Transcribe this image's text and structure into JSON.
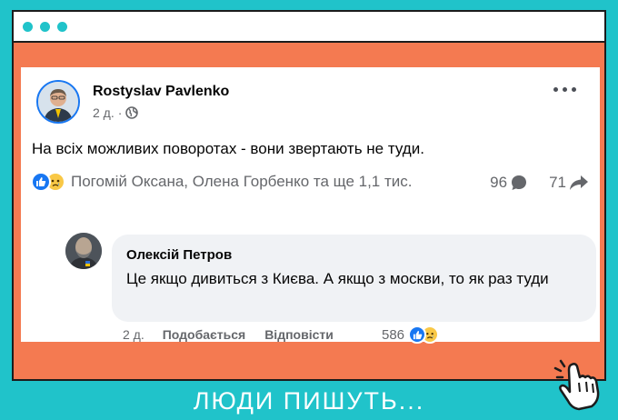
{
  "window": {
    "dots": 3
  },
  "post": {
    "author": "Rostyslav Pavlenko",
    "time": "2 д.",
    "separator": "·",
    "text": "На всіх можливих поворотах - вони звертають не туди.",
    "reactions": {
      "types": [
        "like",
        "sad"
      ],
      "summary": "Погомій Оксана, Олена Горбенко та ще 1,1 тис.",
      "comments_count": "96",
      "shares_count": "71"
    }
  },
  "comment": {
    "author": "Олексій Петров",
    "text": "Це якщо дивиться з Києва. А якщо з москви, то як раз туди",
    "time": "2 д.",
    "like_label": "Подобається",
    "reply_label": "Відповісти",
    "reactions_count": "586",
    "reaction_types": [
      "like",
      "sad"
    ]
  },
  "footer": {
    "caption": "ЛЮДИ ПИШУТЬ..."
  },
  "colors": {
    "background": "#20c3ca",
    "frame": "#f47a51",
    "card": "#ffffff",
    "like_blue": "#1877f2",
    "sad_yellow": "#f9c846",
    "meta_gray": "#65676b",
    "bubble": "#f0f2f5"
  },
  "icons": [
    "globe-icon",
    "more-options-icon",
    "like-icon",
    "sad-icon",
    "comment-icon",
    "share-icon",
    "hand-pointer-icon"
  ]
}
